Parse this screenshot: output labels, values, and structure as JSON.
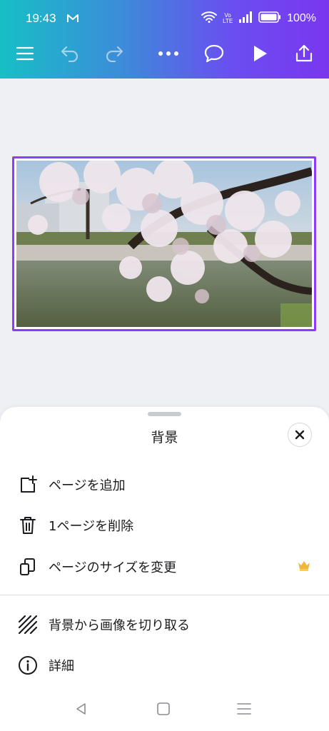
{
  "status_bar": {
    "time": "19:43",
    "network_label": "Vo LTE",
    "battery_percent": "100%"
  },
  "toolbar": {
    "icons": [
      "menu-icon",
      "undo-icon",
      "redo-icon",
      "more-icon",
      "comment-icon",
      "play-icon",
      "share-icon"
    ],
    "accent_color": "#8b3dff"
  },
  "sheet": {
    "title": "背景",
    "items": [
      {
        "label": "ページを追加",
        "icon": "add-page-icon"
      },
      {
        "label": "1ページを削除",
        "icon": "trash-icon"
      },
      {
        "label": "ページのサイズを変更",
        "icon": "resize-icon",
        "premium": true
      },
      {
        "label": "背景から画像を切り取る",
        "icon": "hatch-icon"
      },
      {
        "label": "詳細",
        "icon": "info-icon"
      }
    ],
    "premium_color": "#f2b43d"
  },
  "nav_bar": {
    "icons": [
      "back-icon",
      "home-icon",
      "recents-icon"
    ]
  }
}
